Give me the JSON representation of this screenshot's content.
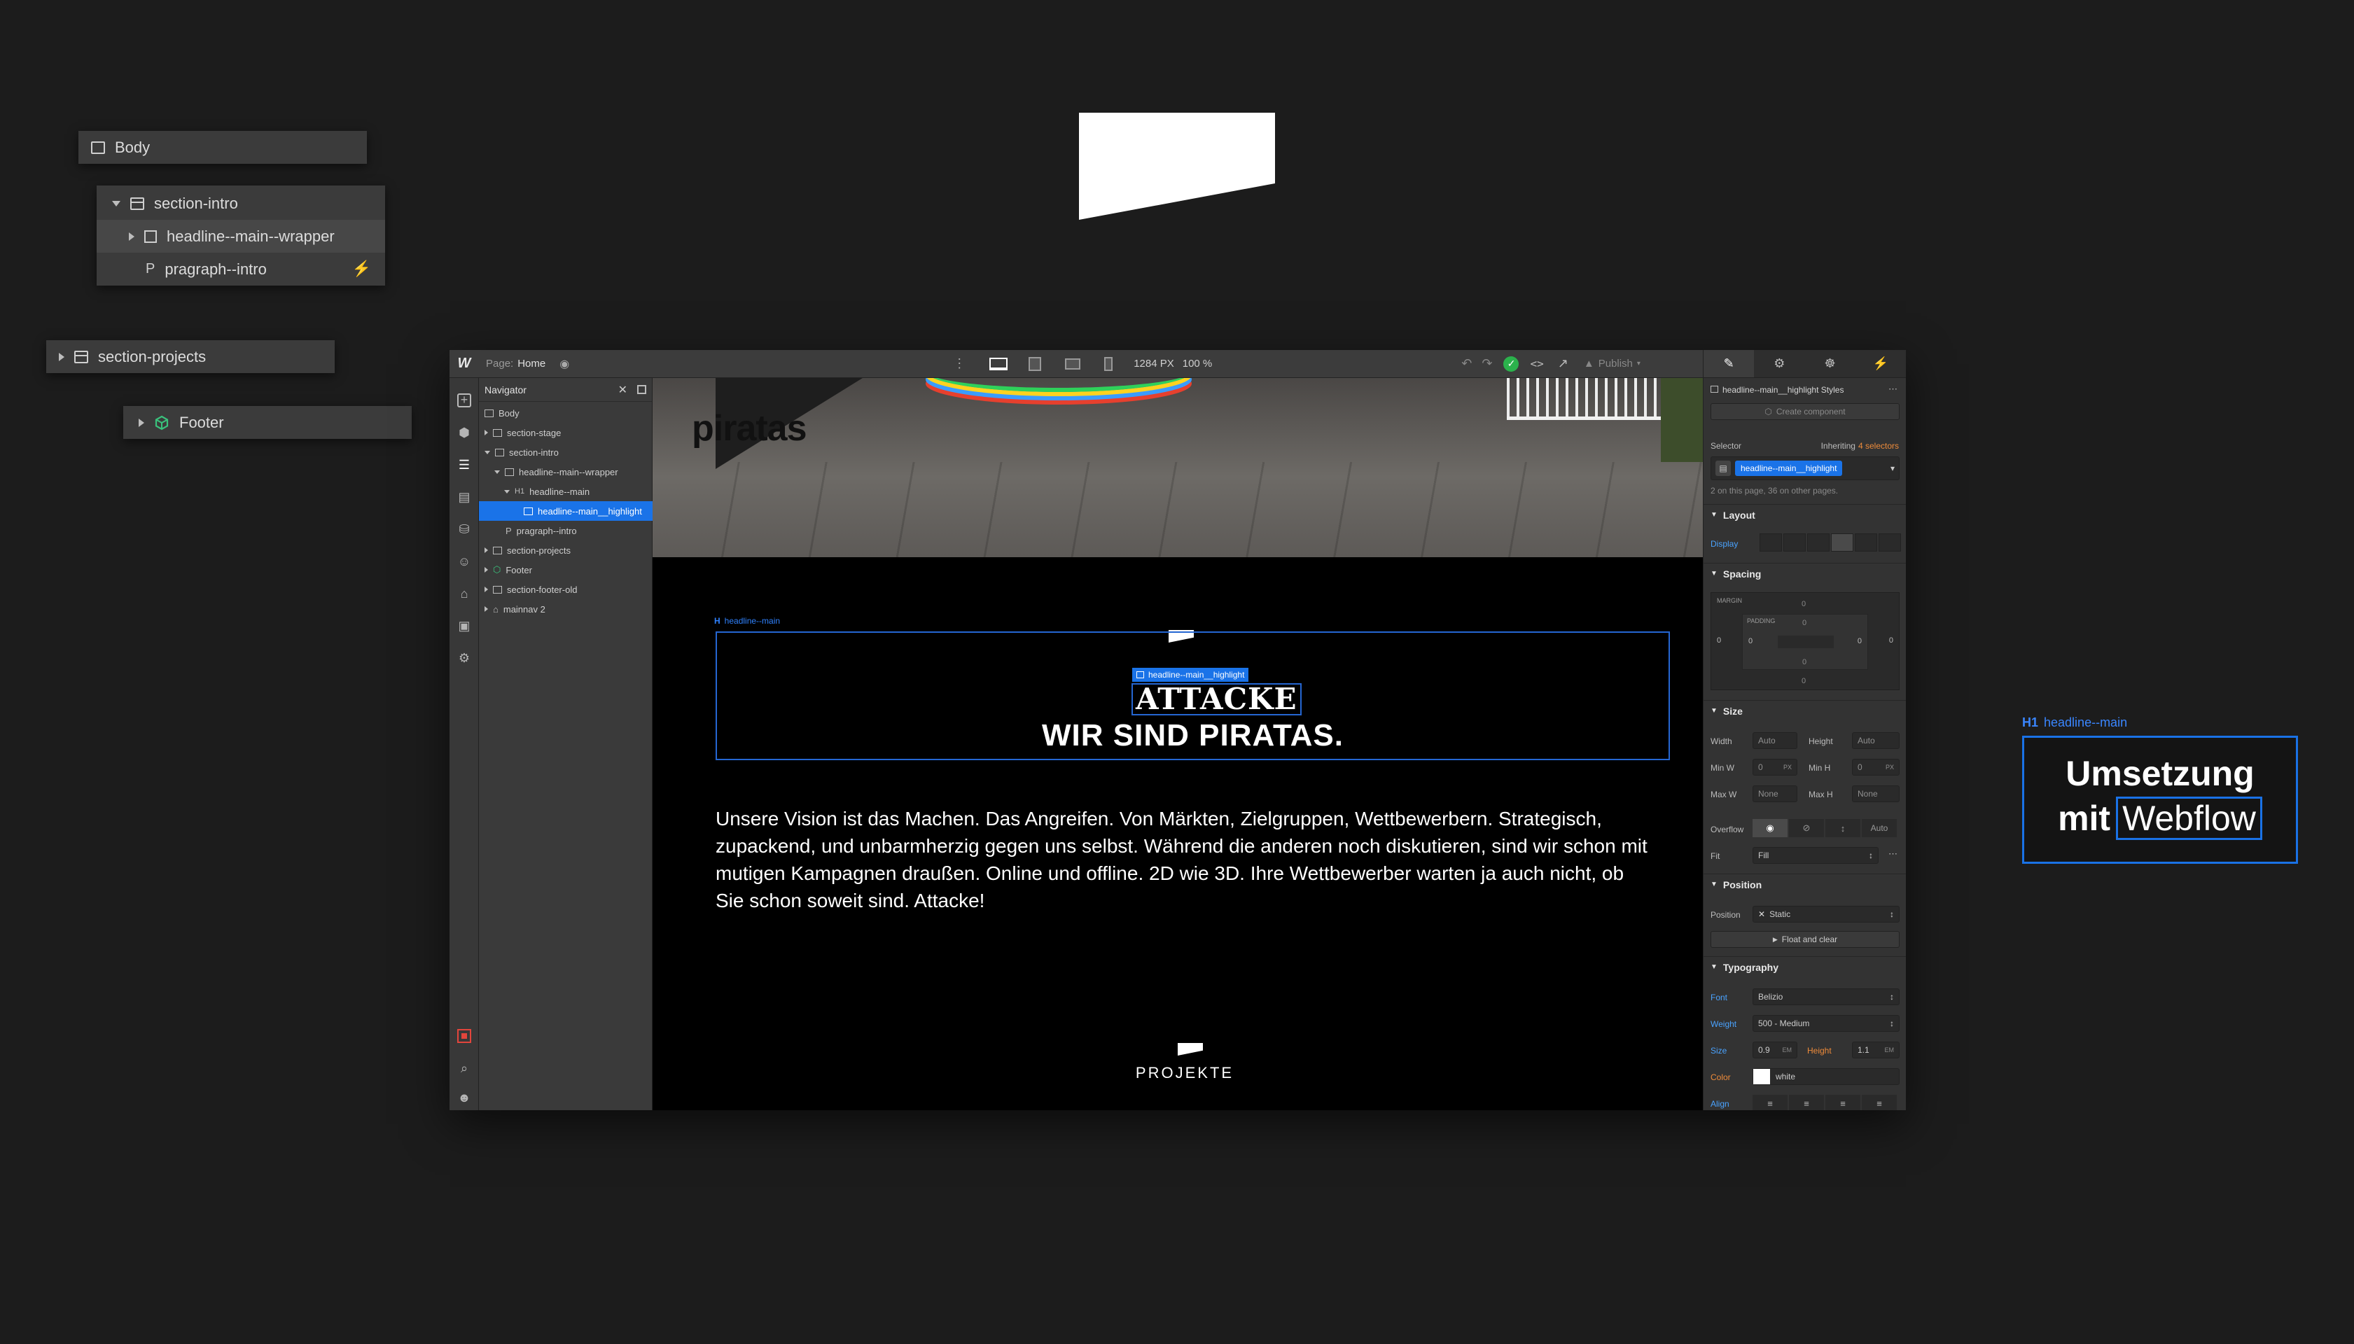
{
  "floating_tree": {
    "body": "Body",
    "section_intro": "section-intro",
    "wrapper": "headline--main--wrapper",
    "paragraph": "pragraph--intro",
    "paragraph_prefix": "P",
    "section_projects": "section-projects",
    "footer": "Footer"
  },
  "topbar": {
    "page_label": "Page:",
    "page_name": "Home",
    "width": "1284 PX",
    "zoom": "100 %",
    "publish": "Publish"
  },
  "navigator": {
    "title": "Navigator",
    "items": [
      {
        "label": "Body"
      },
      {
        "label": "section-stage"
      },
      {
        "label": "section-intro"
      },
      {
        "label": "headline--main--wrapper"
      },
      {
        "label": "headline--main"
      },
      {
        "label": "headline--main__highlight"
      },
      {
        "label": "pragraph--intro"
      },
      {
        "label": "section-projects"
      },
      {
        "label": "Footer"
      },
      {
        "label": "section-footer-old"
      },
      {
        "label": "mainnav 2"
      }
    ]
  },
  "canvas": {
    "brand": "piratas",
    "h1_tag": "headline--main",
    "highlight_tag": "headline--main__highlight",
    "headline_highlight": "ATTACKE",
    "headline_rest": "WIR SIND PIRATAS.",
    "paragraph": "Unsere Vision ist das Machen. Das Angreifen. Von Märkten, Zielgruppen, Wettbewerbern. Strategisch, zupackend, und unbarmherzig gegen uns selbst. Während die anderen noch diskutieren, sind wir schon mit mutigen Kampagnen draußen. Online und offline. 2D wie 3D. Ihre Wettbewerber warten ja auch nicht, ob Sie schon soweit sind. Attacke!",
    "projects": "PROJEKTE"
  },
  "style_panel": {
    "styles_title": "headline--main__highlight Styles",
    "create_component": "Create component",
    "selector_label": "Selector",
    "inheriting_prefix": "Inheriting",
    "inheriting_count": "4 selectors",
    "selector_value": "headline--main__highlight",
    "selector_note": "2 on this page, 36 on other pages.",
    "layout": "Layout",
    "display": "Display",
    "spacing": "Spacing",
    "margin": "MARGIN",
    "padding": "PADDING",
    "zero": "0",
    "size": "Size",
    "width": "Width",
    "height": "Height",
    "min_w": "Min W",
    "min_h": "Min H",
    "max_w": "Max W",
    "max_h": "Max H",
    "auto": "Auto",
    "none": "None",
    "px": "PX",
    "overflow": "Overflow",
    "overflow_auto": "Auto",
    "fit": "Fit",
    "fit_value": "Fill",
    "position_header": "Position",
    "position": "Position",
    "position_value": "Static",
    "float_clear": "Float and clear",
    "typography": "Typography",
    "font": "Font",
    "font_value": "Belizio",
    "weight": "Weight",
    "weight_value": "500 - Medium",
    "size_label": "Size",
    "size_value": "0.9",
    "size_unit": "EM",
    "height_label": "Height",
    "height_value": "1.1",
    "color": "Color",
    "color_value": "white",
    "align": "Align"
  },
  "card": {
    "tag_prefix": "H1",
    "tag": "headline--main",
    "line1": "Umsetzung",
    "line2a": "mit",
    "line2b": "Webflow"
  },
  "colors": {
    "background": "#1c1c1c",
    "accent": "#1a72e6",
    "selection": "#1a73e8"
  }
}
